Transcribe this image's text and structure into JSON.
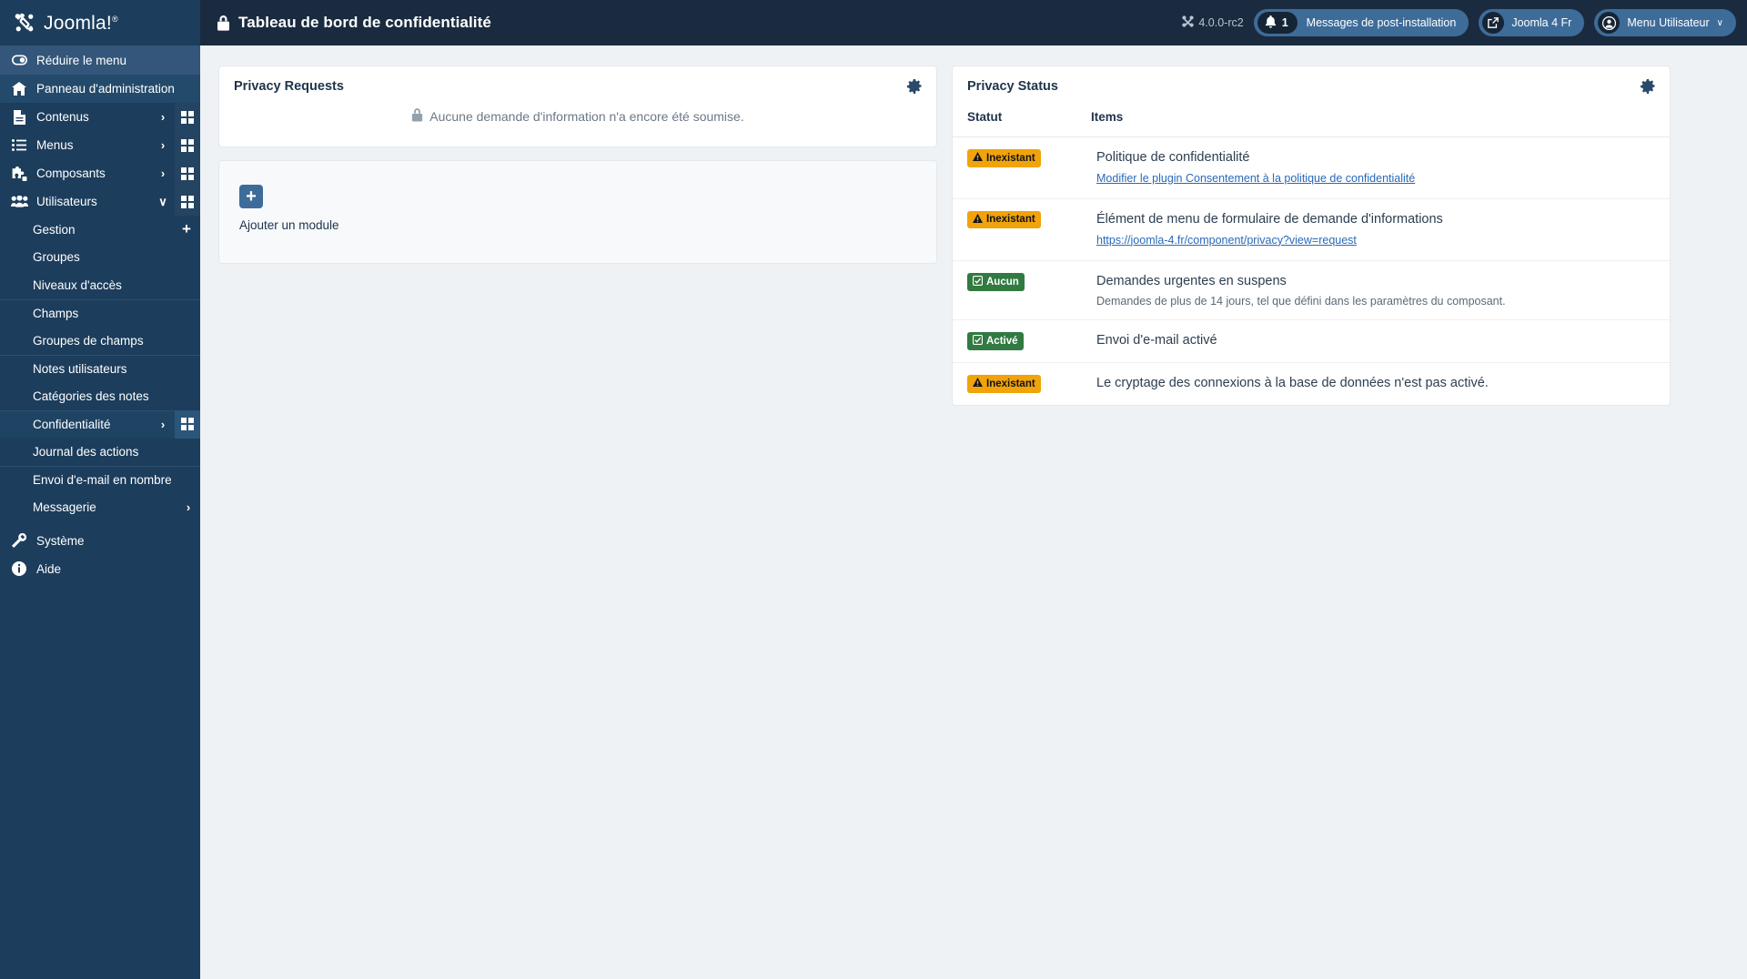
{
  "brand": {
    "name": "Joomla!",
    "trademark": "®"
  },
  "sidebar": {
    "collapse": {
      "label": "Réduire le menu",
      "icon": "collapse-toggle-icon"
    },
    "items": [
      {
        "label": "Panneau d'administration",
        "icon": "home-icon",
        "caret": "",
        "grid": false,
        "active": true
      },
      {
        "label": "Contenus",
        "icon": "document-icon",
        "caret": "›",
        "grid": true
      },
      {
        "label": "Menus",
        "icon": "list-icon",
        "caret": "›",
        "grid": true
      },
      {
        "label": "Composants",
        "icon": "puzzle-icon",
        "caret": "›",
        "grid": true
      },
      {
        "label": "Utilisateurs",
        "icon": "users-icon",
        "caret": "∨",
        "grid": true,
        "expanded": true
      }
    ],
    "subitems": [
      {
        "label": "Gestion",
        "plus": "+"
      },
      {
        "label": "Groupes"
      },
      {
        "label": "Niveaux d'accès"
      },
      {
        "label": "Champs",
        "separator": true
      },
      {
        "label": "Groupes de champs"
      },
      {
        "label": "Notes utilisateurs",
        "separator": true
      },
      {
        "label": "Catégories des notes"
      },
      {
        "label": "Confidentialité",
        "separator": true,
        "caret": "›",
        "grid": true,
        "current": true
      },
      {
        "label": "Journal des actions"
      },
      {
        "label": "Envoi d'e-mail en nombre",
        "separator": true
      },
      {
        "label": "Messagerie",
        "caret": "›"
      }
    ],
    "bottom": [
      {
        "label": "Système",
        "icon": "wrench-icon"
      },
      {
        "label": "Aide",
        "icon": "info-icon"
      }
    ]
  },
  "topbar": {
    "title": "Tableau de bord de confidentialité",
    "title_icon": "lock-icon",
    "version": "4.0.0-rc2",
    "version_icon": "joomla-icon",
    "postinstall": {
      "count": "1",
      "label": "Messages de post-installation",
      "icon": "bell-icon"
    },
    "site": {
      "label": "Joomla 4 Fr",
      "icon": "external-link-icon"
    },
    "user": {
      "label": "Menu Utilisateur",
      "icon": "user-circle-icon",
      "caret": "∨"
    }
  },
  "main": {
    "privacy_requests": {
      "title": "Privacy Requests",
      "gear_icon": "gear-icon",
      "empty_icon": "lock-icon",
      "empty_message": "Aucune demande d'information n'a encore été soumise."
    },
    "module_placeholder": {
      "add_label": "Ajouter un module",
      "plus": "+"
    },
    "privacy_status": {
      "title": "Privacy Status",
      "gear_icon": "gear-icon",
      "columns": [
        "Statut",
        "Items"
      ],
      "rows": [
        {
          "badge": {
            "text": "Inexistant",
            "type": "warn",
            "icon": "warning-icon"
          },
          "item": "Politique de confidentialité",
          "link": "Modifier le plugin Consentement à la politique de confidentialité"
        },
        {
          "badge": {
            "text": "Inexistant",
            "type": "warn",
            "icon": "warning-icon"
          },
          "item": "Élément de menu de formulaire de demande d'informations",
          "link": "https://joomla-4.fr/component/privacy?view=request"
        },
        {
          "badge": {
            "text": "Aucun",
            "type": "ok",
            "icon": "check-square-icon"
          },
          "item": "Demandes urgentes en suspens",
          "note": "Demandes de plus de 14 jours, tel que défini dans les paramètres du composant."
        },
        {
          "badge": {
            "text": "Activé",
            "type": "ok",
            "icon": "check-square-icon"
          },
          "item": "Envoi d'e-mail activé"
        },
        {
          "badge": {
            "text": "Inexistant",
            "type": "warn",
            "icon": "warning-icon"
          },
          "item": "Le cryptage des connexions à la base de données n'est pas activé."
        }
      ]
    }
  },
  "colors": {
    "sidebar_bg": "#1c3d5c",
    "topbar_bg": "#1a2b40",
    "accent": "#3e6c99",
    "warn": "#f0a30a",
    "ok": "#317a41",
    "link": "#2a69b8"
  }
}
